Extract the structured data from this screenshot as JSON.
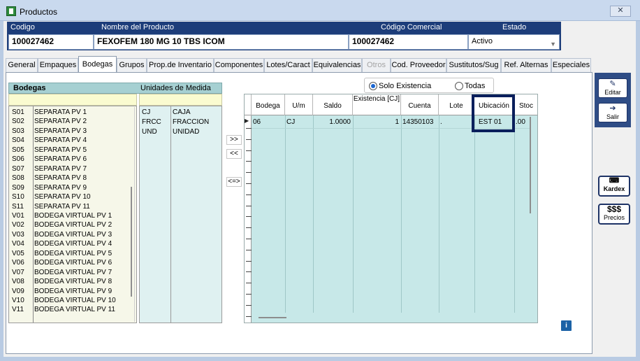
{
  "window": {
    "title": "Productos",
    "close_label": "✕"
  },
  "header": {
    "codigo_label": "Codigo",
    "codigo_value": "100027462",
    "nombre_label": "Nombre del Producto",
    "nombre_value": "FEXOFEM 180 MG 10 TBS ICOM",
    "comercial_label": "Código Comercial",
    "comercial_value": "100027462",
    "estado_label": "Estado",
    "estado_value": "Activo"
  },
  "tabs": [
    {
      "label": "General"
    },
    {
      "label": "Empaques"
    },
    {
      "label": "Bodegas"
    },
    {
      "label": "Grupos"
    },
    {
      "label": "Prop.de Inventario"
    },
    {
      "label": "Componentes"
    },
    {
      "label": "Lotes/Caract"
    },
    {
      "label": "Equivalencias"
    },
    {
      "label": "Otros"
    },
    {
      "label": "Cod. Proveedor"
    },
    {
      "label": "Sustitutos/Sug"
    },
    {
      "label": "Ref. Alternas"
    },
    {
      "label": "Especiales"
    }
  ],
  "bodegas": {
    "title": "Bodegas",
    "um_title": "Unidades de Medida",
    "items": [
      {
        "code": "S01",
        "name": "SEPARATA PV 1"
      },
      {
        "code": "S02",
        "name": "SEPARATA PV 2"
      },
      {
        "code": "S03",
        "name": "SEPARATA PV 3"
      },
      {
        "code": "S04",
        "name": "SEPARATA PV 4"
      },
      {
        "code": "S05",
        "name": "SEPARATA PV 5"
      },
      {
        "code": "S06",
        "name": "SEPARATA PV 6"
      },
      {
        "code": "S07",
        "name": "SEPARATA PV 7"
      },
      {
        "code": "S08",
        "name": "SEPARATA PV 8"
      },
      {
        "code": "S09",
        "name": "SEPARATA PV 9"
      },
      {
        "code": "S10",
        "name": "SEPARATA PV 10"
      },
      {
        "code": "S11",
        "name": "SEPARATA PV 11"
      },
      {
        "code": "V01",
        "name": "BODEGA VIRTUAL PV 1"
      },
      {
        "code": "V02",
        "name": "BODEGA VIRTUAL PV 2"
      },
      {
        "code": "V03",
        "name": "BODEGA VIRTUAL PV 3"
      },
      {
        "code": "V04",
        "name": "BODEGA VIRTUAL PV 4"
      },
      {
        "code": "V05",
        "name": "BODEGA VIRTUAL PV 5"
      },
      {
        "code": "V06",
        "name": "BODEGA VIRTUAL PV 6"
      },
      {
        "code": "V07",
        "name": "BODEGA VIRTUAL PV 7"
      },
      {
        "code": "V08",
        "name": "BODEGA VIRTUAL PV 8"
      },
      {
        "code": "V09",
        "name": "BODEGA VIRTUAL PV 9"
      },
      {
        "code": "V10",
        "name": "BODEGA VIRTUAL PV 10"
      },
      {
        "code": "V11",
        "name": "BODEGA VIRTUAL PV 11"
      }
    ]
  },
  "unidades": [
    {
      "code": "CJ",
      "name": "CAJA"
    },
    {
      "code": "FRCC",
      "name": "FRACCION"
    },
    {
      "code": "UND",
      "name": "UNIDAD"
    }
  ],
  "move_buttons": [
    ">>",
    "<<",
    "<=>"
  ],
  "filter": {
    "solo_label": "Solo Existencia",
    "todas_label": "Todas"
  },
  "grid": {
    "columns": {
      "bodega": "Bodega",
      "um": "U/m",
      "saldo": "Saldo",
      "existencia": "Existencia [CJ]",
      "cuenta": "Cuenta",
      "lote": "Lote",
      "ubicacion": "Ubicación",
      "stock": "Stoc"
    },
    "row": {
      "bodega": "06",
      "um": "CJ",
      "saldo": "1.0000",
      "existencia": "1",
      "cuenta": "14350103",
      "lote": ".",
      "ubicacion": "EST 01",
      "stock": ".00"
    }
  },
  "toolbar": {
    "editar": "Editar",
    "salir": "Salir",
    "kardex": "Kardex",
    "precios_symbol": "$$$",
    "precios": "Precios"
  },
  "info_label": "i"
}
